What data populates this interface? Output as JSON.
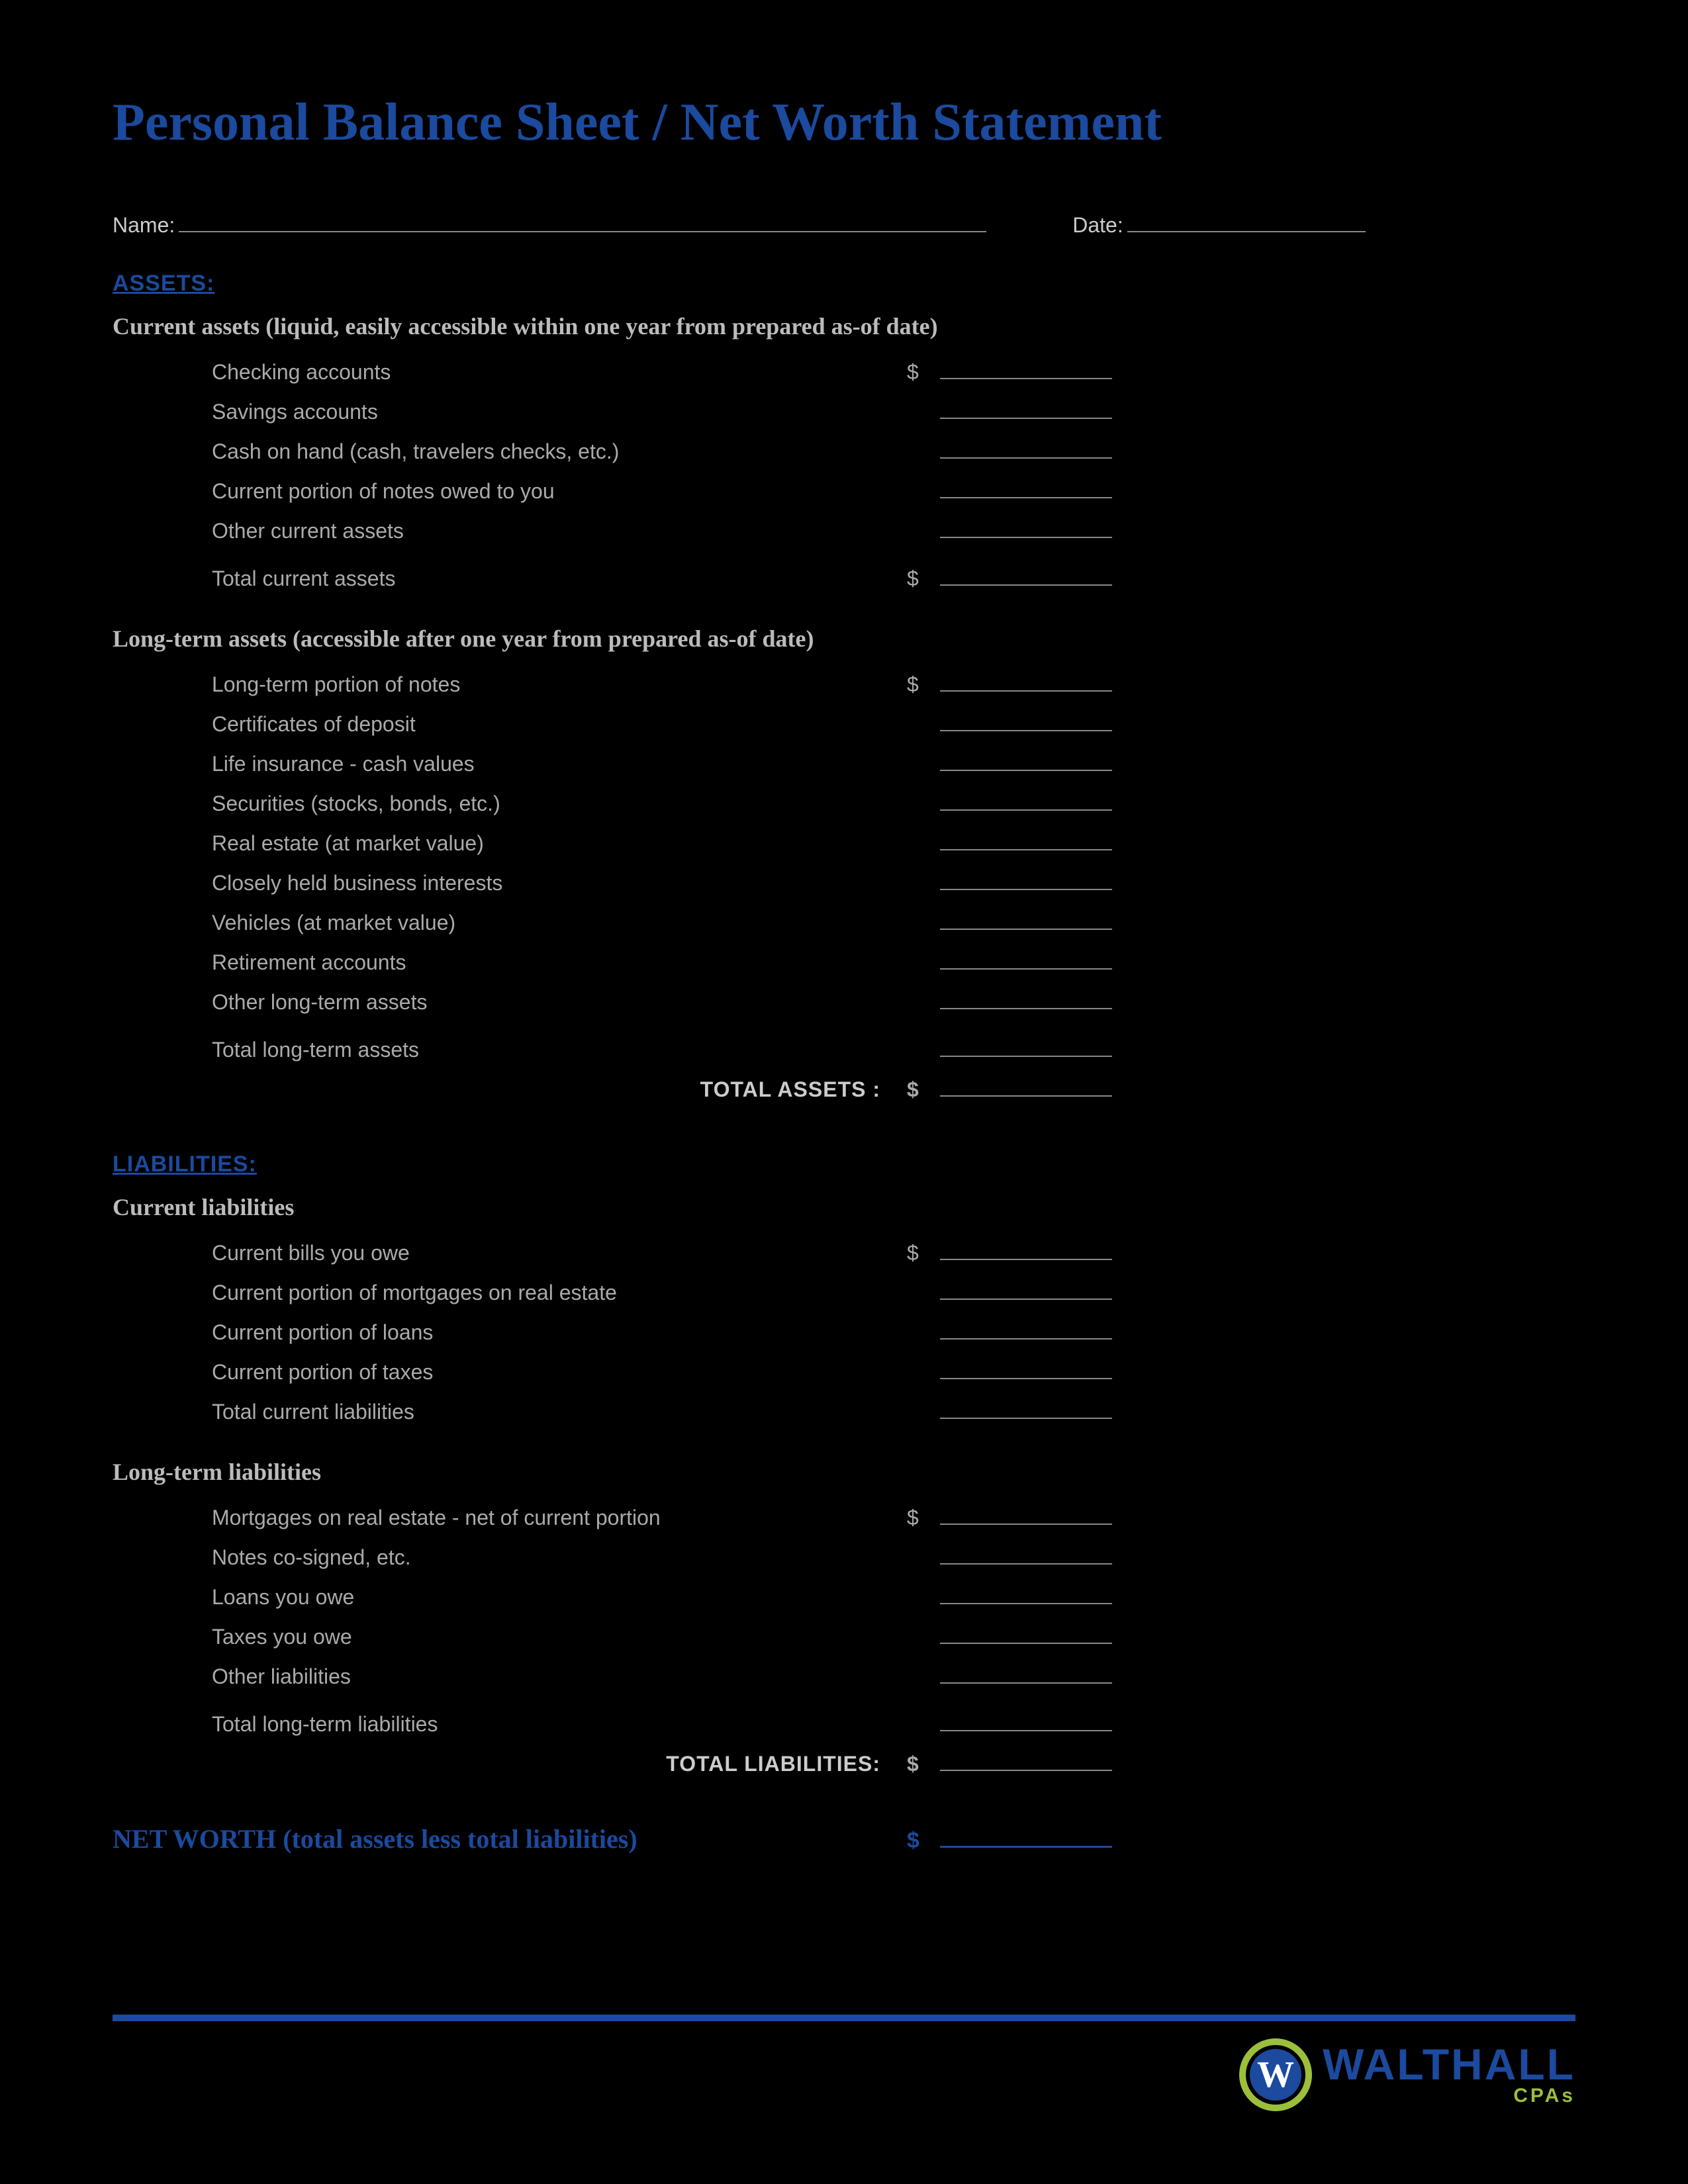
{
  "title": "Personal Balance Sheet / Net Worth Statement",
  "meta": {
    "name_label": "Name:",
    "date_label": "Date:"
  },
  "assets": {
    "header": "ASSETS:",
    "current": {
      "subhead": "Current assets (liquid, easily accessible within one year from prepared as-of date)",
      "items": [
        "Checking accounts",
        "Savings accounts",
        "Cash on hand (cash, travelers checks, etc.)",
        "Current portion of notes owed to you",
        "Other current assets"
      ],
      "total_label": "Total current assets"
    },
    "longterm": {
      "subhead": "Long-term assets (accessible after one year from prepared as-of date)",
      "items": [
        "Long-term portion of notes",
        "Certificates of deposit",
        "Life insurance - cash values",
        "Securities (stocks, bonds, etc.)",
        "Real estate (at market value)",
        "Closely held business interests",
        "Vehicles (at market value)",
        "Retirement accounts",
        "Other long-term assets"
      ],
      "total_label": "Total long-term assets"
    },
    "grand_label": "TOTAL ASSETS :"
  },
  "liabilities": {
    "header": "LIABILITIES:",
    "current": {
      "subhead": "Current liabilities",
      "items": [
        "Current bills you owe",
        "Current portion of mortgages on real estate",
        "Current portion of loans",
        "Current portion of taxes"
      ],
      "total_label": "Total current liabilities"
    },
    "longterm": {
      "subhead": "Long-term liabilities",
      "items": [
        "Mortgages on real estate - net of current portion",
        "Notes co-signed, etc.",
        "Loans you owe",
        "Taxes you owe",
        "Other liabilities"
      ],
      "total_label": "Total long-term liabilities"
    },
    "grand_label": "TOTAL LIABILITIES:"
  },
  "networth_label": "NET WORTH (total assets less total liabilities)",
  "dollar": "$",
  "brand": {
    "name": "WALTHALL",
    "sub": "CPAs",
    "mark": "W"
  }
}
